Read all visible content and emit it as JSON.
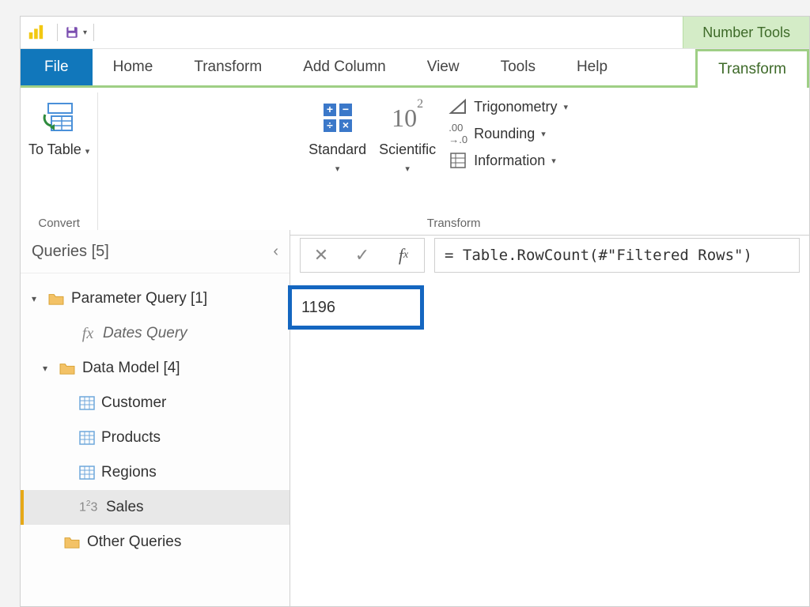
{
  "titlebar": {
    "context_badge": "Number Tools"
  },
  "tabs": {
    "file": "File",
    "home": "Home",
    "transform": "Transform",
    "add_column": "Add Column",
    "view": "View",
    "tools": "Tools",
    "help": "Help",
    "context_transform": "Transform"
  },
  "ribbon": {
    "groups": {
      "convert": {
        "label": "Convert",
        "to_table": "To Table"
      },
      "transform": {
        "label": "Transform",
        "standard": "Standard",
        "scientific": "Scientific",
        "trigonometry": "Trigonometry",
        "rounding": "Rounding",
        "information": "Information"
      }
    }
  },
  "queries": {
    "header": "Queries [5]",
    "folders": [
      {
        "name": "Parameter Query [1]"
      },
      {
        "name": "Data Model [4]"
      },
      {
        "name": "Other Queries"
      }
    ],
    "items": {
      "dates_query": "Dates Query",
      "customer": "Customer",
      "products": "Products",
      "regions": "Regions",
      "sales": "Sales"
    }
  },
  "formula_bar": {
    "expression": "= Table.RowCount(#\"Filtered Rows\")"
  },
  "result": {
    "value": "1196"
  }
}
